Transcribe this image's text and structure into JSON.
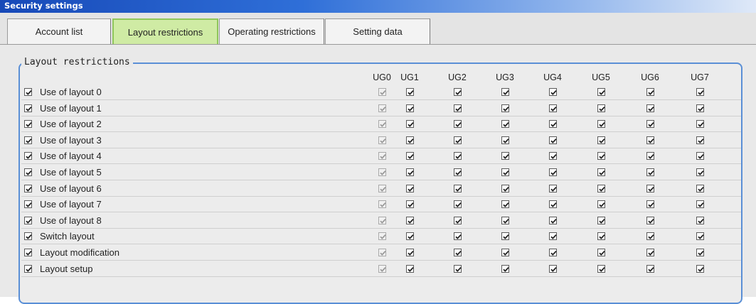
{
  "window": {
    "title": "Security settings"
  },
  "tabs": [
    {
      "label": "Account list",
      "active": false
    },
    {
      "label": "Layout restrictions",
      "active": true
    },
    {
      "label": "Operating restrictions",
      "active": false
    },
    {
      "label": "Setting data",
      "active": false
    }
  ],
  "group": {
    "legend": "Layout restrictions"
  },
  "columns": [
    "UG0",
    "UG1",
    "UG2",
    "UG3",
    "UG4",
    "UG5",
    "UG6",
    "UG7"
  ],
  "rows": [
    {
      "label": "Use of layout 0",
      "checked": true,
      "ug": [
        true,
        true,
        true,
        true,
        true,
        true,
        true,
        true
      ],
      "ug0_disabled": true
    },
    {
      "label": "Use of layout 1",
      "checked": true,
      "ug": [
        true,
        true,
        true,
        true,
        true,
        true,
        true,
        true
      ],
      "ug0_disabled": true
    },
    {
      "label": "Use of layout 2",
      "checked": true,
      "ug": [
        true,
        true,
        true,
        true,
        true,
        true,
        true,
        true
      ],
      "ug0_disabled": true
    },
    {
      "label": "Use of layout 3",
      "checked": true,
      "ug": [
        true,
        true,
        true,
        true,
        true,
        true,
        true,
        true
      ],
      "ug0_disabled": true
    },
    {
      "label": "Use of layout 4",
      "checked": true,
      "ug": [
        true,
        true,
        true,
        true,
        true,
        true,
        true,
        true
      ],
      "ug0_disabled": true
    },
    {
      "label": "Use of layout 5",
      "checked": true,
      "ug": [
        true,
        true,
        true,
        true,
        true,
        true,
        true,
        true
      ],
      "ug0_disabled": true
    },
    {
      "label": "Use of layout 6",
      "checked": true,
      "ug": [
        true,
        true,
        true,
        true,
        true,
        true,
        true,
        true
      ],
      "ug0_disabled": true
    },
    {
      "label": "Use of layout 7",
      "checked": true,
      "ug": [
        true,
        true,
        true,
        true,
        true,
        true,
        true,
        true
      ],
      "ug0_disabled": true
    },
    {
      "label": "Use of layout 8",
      "checked": true,
      "ug": [
        true,
        true,
        true,
        true,
        true,
        true,
        true,
        true
      ],
      "ug0_disabled": true
    },
    {
      "label": "Switch layout",
      "checked": true,
      "ug": [
        true,
        true,
        true,
        true,
        true,
        true,
        true,
        true
      ],
      "ug0_disabled": true
    },
    {
      "label": "Layout modification",
      "checked": true,
      "ug": [
        true,
        true,
        true,
        true,
        true,
        true,
        true,
        true
      ],
      "ug0_disabled": true
    },
    {
      "label": "Layout setup",
      "checked": true,
      "ug": [
        true,
        true,
        true,
        true,
        true,
        true,
        true,
        true
      ],
      "ug0_disabled": true
    }
  ],
  "colors": {
    "title_gradient_start": "#1749b8",
    "active_tab": "#cfeba4",
    "group_border": "#5a8fd6"
  }
}
